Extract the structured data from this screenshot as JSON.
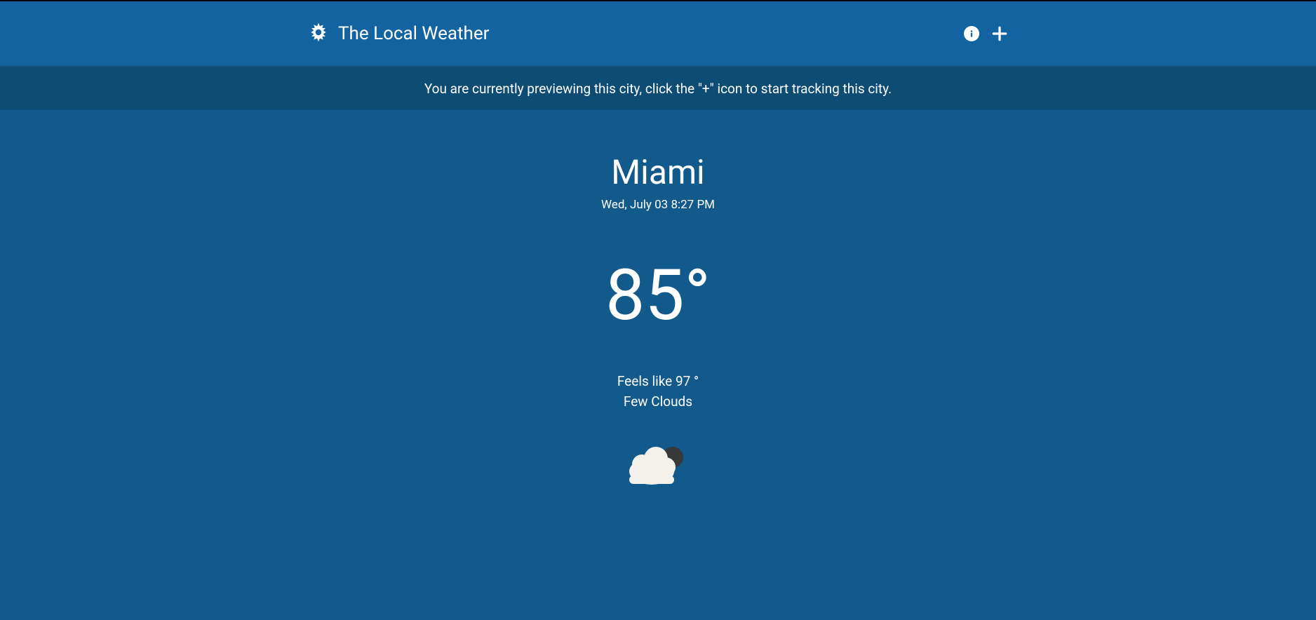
{
  "header": {
    "title": "The Local Weather"
  },
  "banner": {
    "message": "You are currently previewing this city, click the \"+\" icon to start tracking this city."
  },
  "weather": {
    "city": "Miami",
    "datetime": "Wed, July 03 8:27 PM",
    "temperature": "85°",
    "feels_like": "Feels like 97 °",
    "condition": "Few Clouds"
  }
}
